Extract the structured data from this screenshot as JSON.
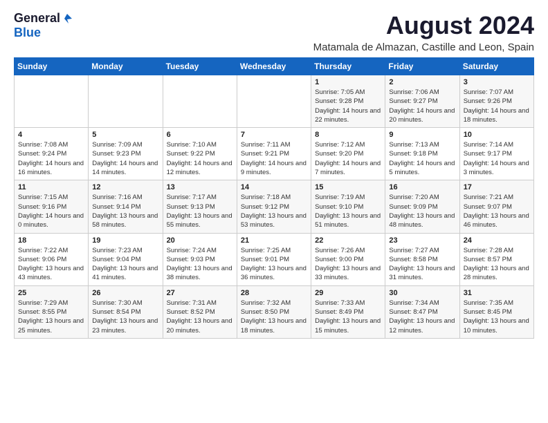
{
  "logo": {
    "general": "General",
    "blue": "Blue"
  },
  "title": "August 2024",
  "subtitle": "Matamala de Almazan, Castille and Leon, Spain",
  "days_of_week": [
    "Sunday",
    "Monday",
    "Tuesday",
    "Wednesday",
    "Thursday",
    "Friday",
    "Saturday"
  ],
  "weeks": [
    [
      {
        "day": "",
        "info": ""
      },
      {
        "day": "",
        "info": ""
      },
      {
        "day": "",
        "info": ""
      },
      {
        "day": "",
        "info": ""
      },
      {
        "day": "1",
        "info": "Sunrise: 7:05 AM\nSunset: 9:28 PM\nDaylight: 14 hours and 22 minutes."
      },
      {
        "day": "2",
        "info": "Sunrise: 7:06 AM\nSunset: 9:27 PM\nDaylight: 14 hours and 20 minutes."
      },
      {
        "day": "3",
        "info": "Sunrise: 7:07 AM\nSunset: 9:26 PM\nDaylight: 14 hours and 18 minutes."
      }
    ],
    [
      {
        "day": "4",
        "info": "Sunrise: 7:08 AM\nSunset: 9:24 PM\nDaylight: 14 hours and 16 minutes."
      },
      {
        "day": "5",
        "info": "Sunrise: 7:09 AM\nSunset: 9:23 PM\nDaylight: 14 hours and 14 minutes."
      },
      {
        "day": "6",
        "info": "Sunrise: 7:10 AM\nSunset: 9:22 PM\nDaylight: 14 hours and 12 minutes."
      },
      {
        "day": "7",
        "info": "Sunrise: 7:11 AM\nSunset: 9:21 PM\nDaylight: 14 hours and 9 minutes."
      },
      {
        "day": "8",
        "info": "Sunrise: 7:12 AM\nSunset: 9:20 PM\nDaylight: 14 hours and 7 minutes."
      },
      {
        "day": "9",
        "info": "Sunrise: 7:13 AM\nSunset: 9:18 PM\nDaylight: 14 hours and 5 minutes."
      },
      {
        "day": "10",
        "info": "Sunrise: 7:14 AM\nSunset: 9:17 PM\nDaylight: 14 hours and 3 minutes."
      }
    ],
    [
      {
        "day": "11",
        "info": "Sunrise: 7:15 AM\nSunset: 9:16 PM\nDaylight: 14 hours and 0 minutes."
      },
      {
        "day": "12",
        "info": "Sunrise: 7:16 AM\nSunset: 9:14 PM\nDaylight: 13 hours and 58 minutes."
      },
      {
        "day": "13",
        "info": "Sunrise: 7:17 AM\nSunset: 9:13 PM\nDaylight: 13 hours and 55 minutes."
      },
      {
        "day": "14",
        "info": "Sunrise: 7:18 AM\nSunset: 9:12 PM\nDaylight: 13 hours and 53 minutes."
      },
      {
        "day": "15",
        "info": "Sunrise: 7:19 AM\nSunset: 9:10 PM\nDaylight: 13 hours and 51 minutes."
      },
      {
        "day": "16",
        "info": "Sunrise: 7:20 AM\nSunset: 9:09 PM\nDaylight: 13 hours and 48 minutes."
      },
      {
        "day": "17",
        "info": "Sunrise: 7:21 AM\nSunset: 9:07 PM\nDaylight: 13 hours and 46 minutes."
      }
    ],
    [
      {
        "day": "18",
        "info": "Sunrise: 7:22 AM\nSunset: 9:06 PM\nDaylight: 13 hours and 43 minutes."
      },
      {
        "day": "19",
        "info": "Sunrise: 7:23 AM\nSunset: 9:04 PM\nDaylight: 13 hours and 41 minutes."
      },
      {
        "day": "20",
        "info": "Sunrise: 7:24 AM\nSunset: 9:03 PM\nDaylight: 13 hours and 38 minutes."
      },
      {
        "day": "21",
        "info": "Sunrise: 7:25 AM\nSunset: 9:01 PM\nDaylight: 13 hours and 36 minutes."
      },
      {
        "day": "22",
        "info": "Sunrise: 7:26 AM\nSunset: 9:00 PM\nDaylight: 13 hours and 33 minutes."
      },
      {
        "day": "23",
        "info": "Sunrise: 7:27 AM\nSunset: 8:58 PM\nDaylight: 13 hours and 31 minutes."
      },
      {
        "day": "24",
        "info": "Sunrise: 7:28 AM\nSunset: 8:57 PM\nDaylight: 13 hours and 28 minutes."
      }
    ],
    [
      {
        "day": "25",
        "info": "Sunrise: 7:29 AM\nSunset: 8:55 PM\nDaylight: 13 hours and 25 minutes."
      },
      {
        "day": "26",
        "info": "Sunrise: 7:30 AM\nSunset: 8:54 PM\nDaylight: 13 hours and 23 minutes."
      },
      {
        "day": "27",
        "info": "Sunrise: 7:31 AM\nSunset: 8:52 PM\nDaylight: 13 hours and 20 minutes."
      },
      {
        "day": "28",
        "info": "Sunrise: 7:32 AM\nSunset: 8:50 PM\nDaylight: 13 hours and 18 minutes."
      },
      {
        "day": "29",
        "info": "Sunrise: 7:33 AM\nSunset: 8:49 PM\nDaylight: 13 hours and 15 minutes."
      },
      {
        "day": "30",
        "info": "Sunrise: 7:34 AM\nSunset: 8:47 PM\nDaylight: 13 hours and 12 minutes."
      },
      {
        "day": "31",
        "info": "Sunrise: 7:35 AM\nSunset: 8:45 PM\nDaylight: 13 hours and 10 minutes."
      }
    ]
  ]
}
